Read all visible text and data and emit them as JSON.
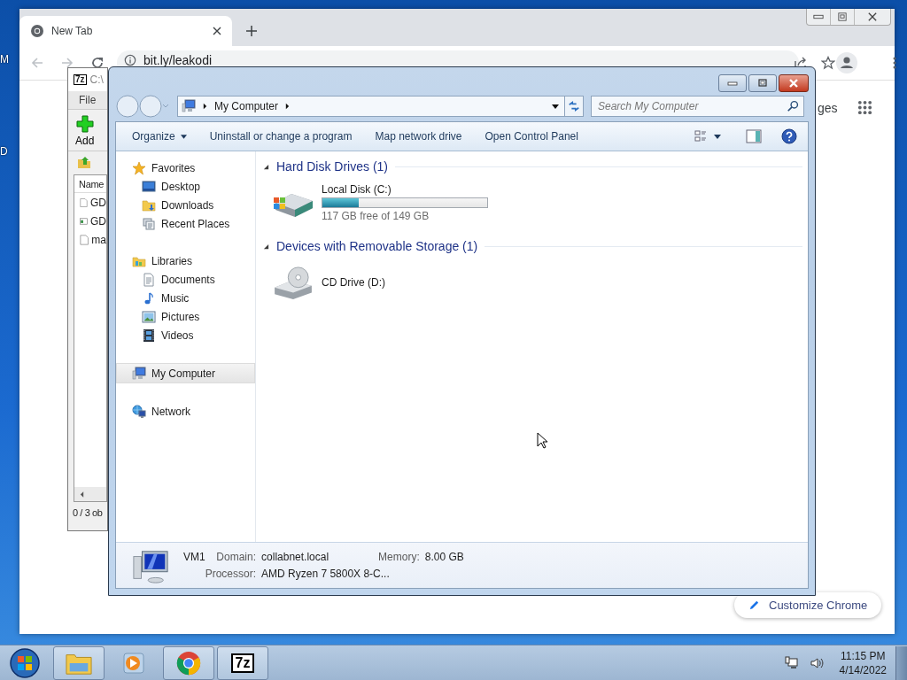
{
  "desktop": {
    "icon_labels": [
      "M",
      "D"
    ]
  },
  "browser": {
    "tabs": [
      {
        "title": "New Tab",
        "selected": true
      }
    ],
    "address": "bit.ly/leakodi",
    "page_text": "ges",
    "customize_button": "Customize Chrome"
  },
  "archiver": {
    "logo": "7z",
    "title": "C:\\",
    "menu": [
      "File"
    ],
    "add_button": "Add",
    "column": "Name",
    "rows": [
      {
        "name": "GD",
        "kind": "file"
      },
      {
        "name": "GD",
        "kind": "window"
      },
      {
        "name": "ma",
        "kind": "file"
      }
    ],
    "status": "0 / 3 ob"
  },
  "explorer": {
    "breadcrumb": [
      "My Computer"
    ],
    "search": {
      "placeholder": "Search My Computer"
    },
    "commands": [
      {
        "label": "Organize",
        "menu": true
      },
      {
        "label": "Uninstall or change a program",
        "menu": false
      },
      {
        "label": "Map network drive",
        "menu": false
      },
      {
        "label": "Open Control Panel",
        "menu": false
      }
    ],
    "nav": [
      {
        "label": "Favorites",
        "selected": false,
        "children": [
          {
            "label": "Desktop",
            "selected": false
          },
          {
            "label": "Downloads",
            "selected": false
          },
          {
            "label": "Recent Places",
            "selected": false
          }
        ]
      },
      {
        "label": "Libraries",
        "selected": false,
        "children": [
          {
            "label": "Documents",
            "selected": false
          },
          {
            "label": "Music",
            "selected": false
          },
          {
            "label": "Pictures",
            "selected": false
          },
          {
            "label": "Videos",
            "selected": false
          }
        ]
      },
      {
        "label": "My Computer",
        "selected": true
      },
      {
        "label": "Network",
        "selected": false
      }
    ],
    "sections": [
      {
        "title": "Hard Disk Drives (1)",
        "expanded": true,
        "items": [
          {
            "name": "Local Disk (C:)",
            "kind": "disk",
            "level": 0.22,
            "space": "117 GB free of 149 GB"
          }
        ]
      },
      {
        "title": "Devices with Removable Storage (1)",
        "expanded": true,
        "items": [
          {
            "name": "CD Drive (D:)",
            "kind": "cd"
          }
        ]
      }
    ],
    "details": {
      "name": "VM1",
      "fields": [
        {
          "label": "Domain:",
          "value": "collabnet.local"
        },
        {
          "label": "Memory:",
          "value": "8.00 GB"
        },
        {
          "label": "Processor:",
          "value": "AMD Ryzen 7 5800X 8-C..."
        }
      ]
    }
  },
  "taskbar": {
    "apps": [
      {
        "kind": "explorer"
      },
      {
        "kind": "media"
      },
      {
        "kind": "chrome"
      },
      {
        "kind": "sevenzip",
        "label": "7z"
      }
    ],
    "clock": {
      "time": "11:15 PM",
      "date": "4/14/2022"
    }
  }
}
